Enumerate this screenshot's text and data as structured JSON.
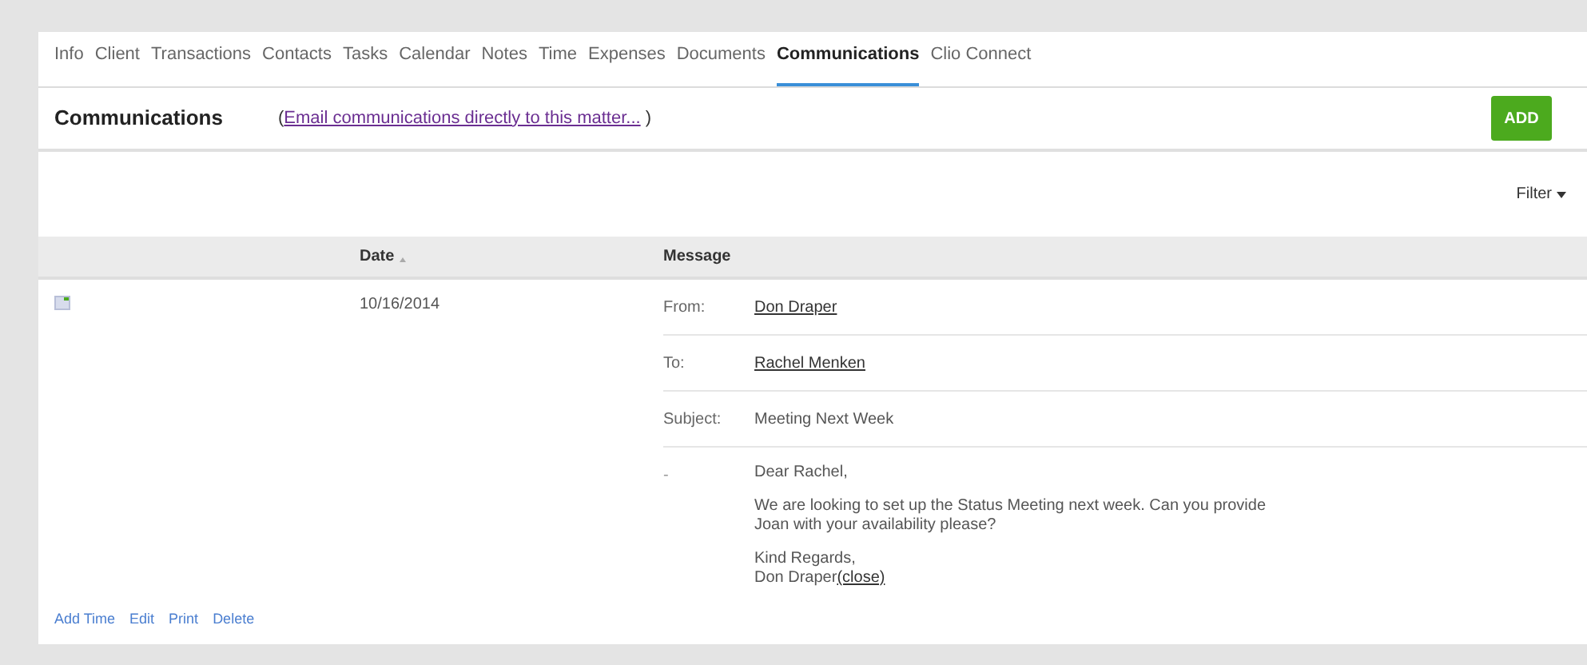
{
  "tabs": [
    {
      "label": "Info",
      "selected": false
    },
    {
      "label": "Client",
      "selected": false
    },
    {
      "label": "Transactions",
      "selected": false
    },
    {
      "label": "Contacts",
      "selected": false
    },
    {
      "label": "Tasks",
      "selected": false
    },
    {
      "label": "Calendar",
      "selected": false
    },
    {
      "label": "Notes",
      "selected": false
    },
    {
      "label": "Time",
      "selected": false
    },
    {
      "label": "Expenses",
      "selected": false
    },
    {
      "label": "Documents",
      "selected": false
    },
    {
      "label": "Communications",
      "selected": true
    },
    {
      "label": "Clio Connect",
      "selected": false
    }
  ],
  "header": {
    "title": "Communications",
    "paren_open": "(",
    "email_link": "Email communications directly to this matter...",
    "paren_close": ")",
    "add_button": "ADD"
  },
  "filter": "Filter",
  "table": {
    "columns": [
      "Date",
      "Message"
    ],
    "rows": [
      {
        "date": "10/16/2014",
        "fields": [
          {
            "label": "From:",
            "value": "Don Draper",
            "kind": "link"
          },
          {
            "label": "To:",
            "value": "Rachel Menken",
            "kind": "link"
          },
          {
            "label": "Subject:",
            "value": "Meeting Next Week",
            "kind": "text"
          }
        ],
        "body_label": "-",
        "body": [
          "Dear Rachel,",
          "We are looking to set up the Status Meeting next week. Can you provide Joan with your availability please?",
          "Kind Regards,"
        ],
        "signature": "Don Draper",
        "close_link": "(close)",
        "actions": [
          "Add Time",
          "Edit",
          "Print",
          "Delete"
        ]
      }
    ]
  }
}
